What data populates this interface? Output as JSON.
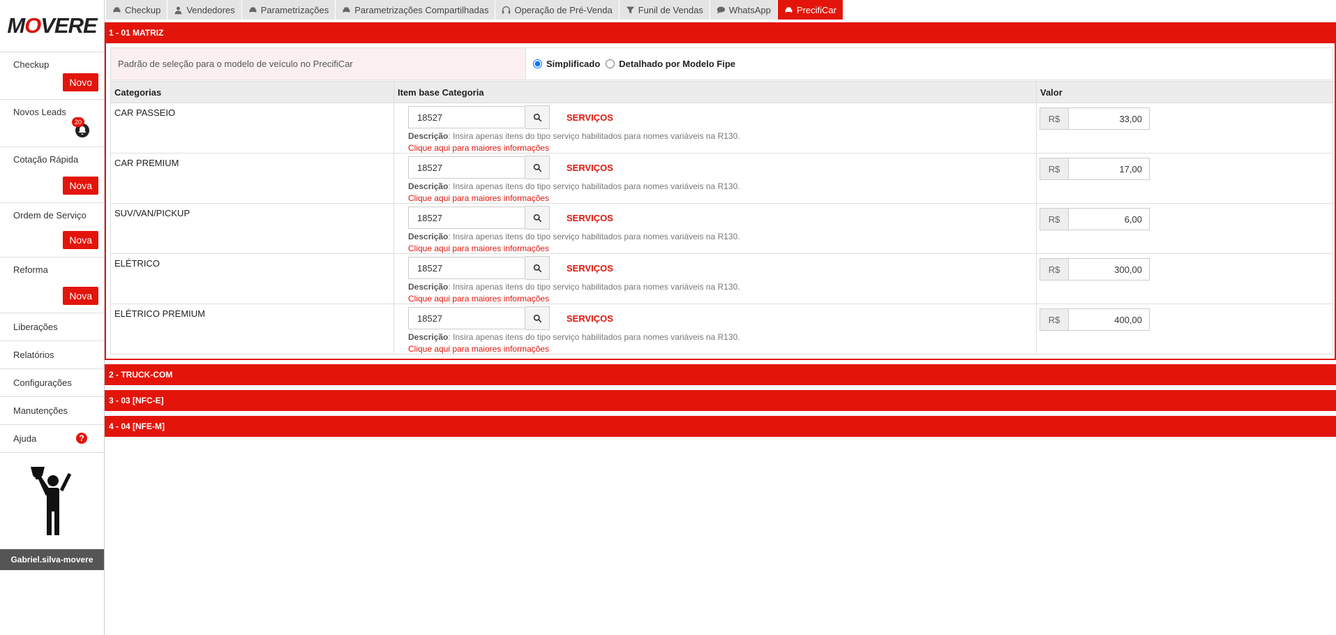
{
  "brand": {
    "logo_text_1": "M",
    "logo_o": "O",
    "logo_text_2": "VERE"
  },
  "tabs": [
    {
      "label": "Checkup",
      "icon": "car-icon"
    },
    {
      "label": "Vendedores",
      "icon": "user-icon"
    },
    {
      "label": "Parametrizações",
      "icon": "car-icon"
    },
    {
      "label": "Parametrizações Compartilhadas",
      "icon": "car-icon"
    },
    {
      "label": "Operação de Pré-Venda",
      "icon": "headset-icon"
    },
    {
      "label": "Funil de Vendas",
      "icon": "filter-icon"
    },
    {
      "label": "WhatsApp",
      "icon": "chat-icon"
    },
    {
      "label": "PrecifiCar",
      "icon": "car-icon",
      "active": true
    }
  ],
  "sidebar": {
    "checkup": {
      "label": "Checkup",
      "button": "Novo"
    },
    "leads": {
      "label": "Novos Leads",
      "badge": "20"
    },
    "cotacao": {
      "label": "Cotação Rápida",
      "button": "Nova"
    },
    "ordem": {
      "label": "Ordem de Serviço",
      "button": "Nova"
    },
    "reforma": {
      "label": "Reforma",
      "button": "Nova"
    },
    "liberacoes": {
      "label": "Liberações"
    },
    "relatorios": {
      "label": "Relatórios"
    },
    "configuracoes": {
      "label": "Configurações"
    },
    "manutencoes": {
      "label": "Manutenções"
    },
    "ajuda": {
      "label": "Ajuda",
      "icon": "?"
    },
    "user": "Gabriel.silva-movere"
  },
  "sections": {
    "s1": "1 - 01 MATRIZ",
    "s2": "2 - TRUCK-COM",
    "s3": "3 - 03 [NFC-E]",
    "s4": "4 - 04 [NFE-M]"
  },
  "preference": {
    "label": "Padrão de seleção para o modelo de veículo no PrecifiCar",
    "option1": "Simplificado",
    "option2": "Detalhado por Modelo Fipe",
    "selected": "Simplificado"
  },
  "table": {
    "headers": {
      "categorias": "Categorias",
      "item": "Item base Categoria",
      "valor": "Valor"
    },
    "desc_label": "Descrição",
    "desc_text": ": Insira apenas itens do tipo serviço habilitados para nomes variáveis na R130.",
    "link_text": "Clique aqui para maiores informações",
    "currency": "R$",
    "rows": [
      {
        "category": "CAR PASSEIO",
        "code": "18527",
        "type": "SERVIÇOS",
        "value": "33,00"
      },
      {
        "category": "CAR PREMIUM",
        "code": "18527",
        "type": "SERVIÇOS",
        "value": "17,00"
      },
      {
        "category": "SUV/VAN/PICKUP",
        "code": "18527",
        "type": "SERVIÇOS",
        "value": "6,00"
      },
      {
        "category": "ELÉTRICO",
        "code": "18527",
        "type": "SERVIÇOS",
        "value": "300,00"
      },
      {
        "category": "ELÉTRICO PREMIUM",
        "code": "18527",
        "type": "SERVIÇOS",
        "value": "400,00"
      }
    ]
  },
  "colors": {
    "accent": "#e3150b",
    "tab_bg": "#e4e4e4",
    "pref_bg": "#fcefef"
  }
}
